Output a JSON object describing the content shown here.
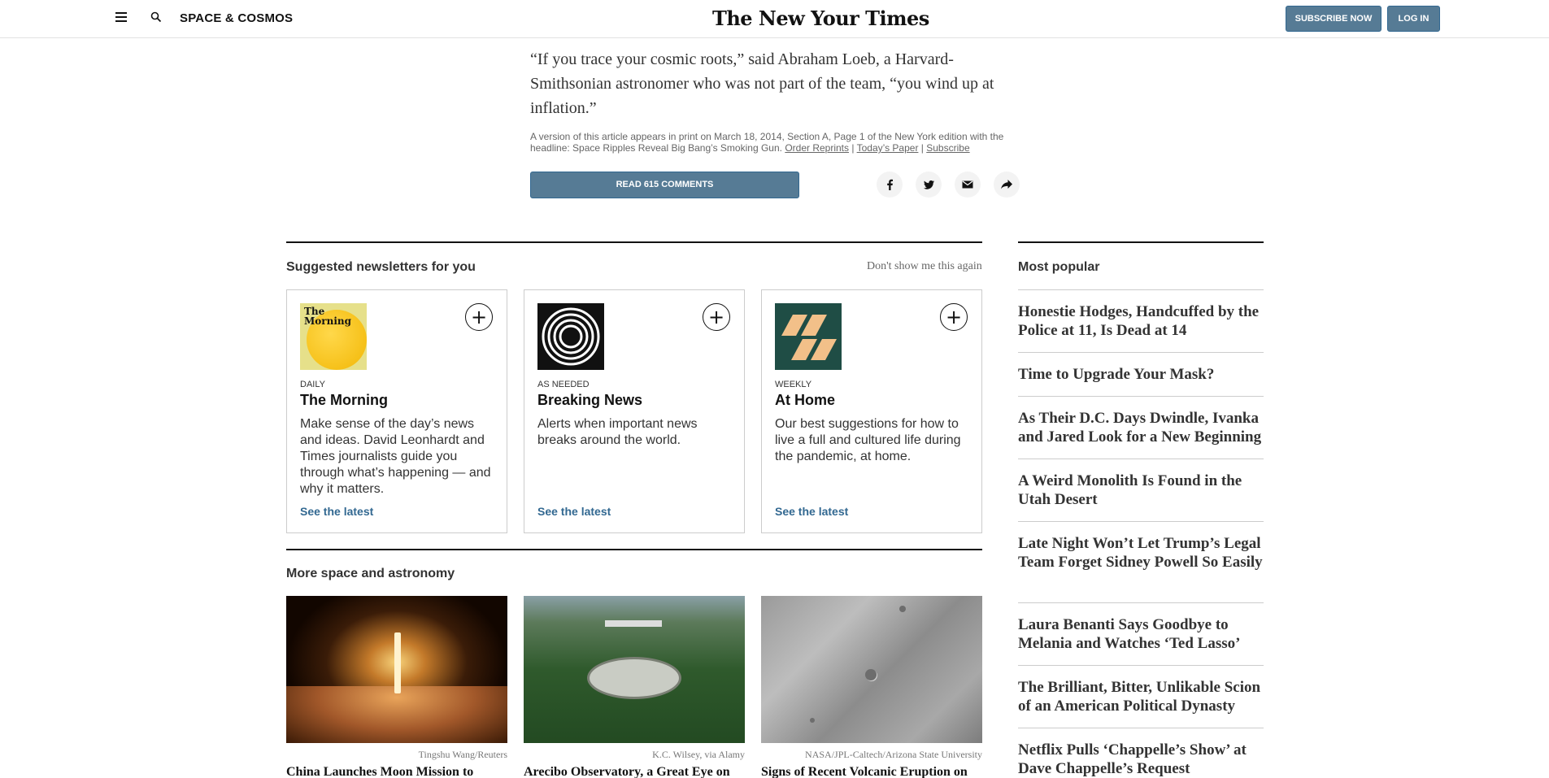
{
  "header": {
    "section": "SPACE & COSMOS",
    "masthead": "The New Yo‌ur Times",
    "subscribe_label": "SUBSCRIBE NOW",
    "login_label": "LOG IN"
  },
  "article": {
    "quote": "“If you trace your cosmic roots,” said Abraham Loeb, a Harvard-Smithsonian astronomer who was not part of the team, “you wind up at inflation.”",
    "print_note": "A version of this article appears in print on March 18, 2014, Section A, Page 1 of the New York edition with the headline: Space Ripples Reveal Big Bang’s Smoking Gun.",
    "order_reprints": "Order Reprints",
    "sep1": "|",
    "todays_paper": "Today’s Paper",
    "sep2": "|",
    "subscribe_link": "Subscribe",
    "comments_label": "READ 615 COMMENTS",
    "share_icons": [
      "facebook-icon",
      "twitter-icon",
      "email-icon",
      "share-icon"
    ]
  },
  "newsletters": {
    "heading": "Suggested newsletters for you",
    "dismiss": "Don't show me this again",
    "items": [
      {
        "frequency": "DAILY",
        "name": "The Morning",
        "thumb_text": "The Morning",
        "description": "Make sense of the day’s news and ideas. David Leonhardt and Times journalists guide you through what’s happening — and why it matters.",
        "link": "See the latest"
      },
      {
        "frequency": "AS NEEDED",
        "name": "Breaking News",
        "description": "Alerts when important news breaks around the world.",
        "link": "See the latest"
      },
      {
        "frequency": "WEEKLY",
        "name": "At Home",
        "description": "Our best suggestions for how to live a full and cultured life during the pandemic, at home.",
        "link": "See the latest"
      }
    ]
  },
  "more": {
    "heading": "More space and astronomy",
    "stories": [
      {
        "credit": "Tingshu Wang/Reuters",
        "headline": "China Launches Moon Mission to"
      },
      {
        "credit": "K.C. Wilsey, via Alamy",
        "headline": "Arecibo Observatory, a Great Eye on"
      },
      {
        "credit": "NASA/JPL-Caltech/Arizona State University",
        "headline": "Signs of Recent Volcanic Eruption on"
      }
    ]
  },
  "most_popular": {
    "heading": "Most popular",
    "items": [
      "Honestie Hodges, Handcuffed by the Police at 11, Is Dead at 14",
      "Time to Upgrade Your Mask?",
      "As Their D.C. Days Dwindle, Ivanka and Jared Look for a New Beginning",
      "A Weird Monolith Is Found in the Utah Desert",
      "Late Night Won’t Let Trump’s Legal Team Forget Sidney Powell So Easily",
      "Laura Benanti Says Goodbye to Melania and Watches ‘Ted Lasso’",
      "The Brilliant, Bitter, Unlikable Scion of an American Political Dynasty",
      "Netflix Pulls ‘Chappelle’s Show’ at Dave Chappelle’s Request"
    ]
  }
}
